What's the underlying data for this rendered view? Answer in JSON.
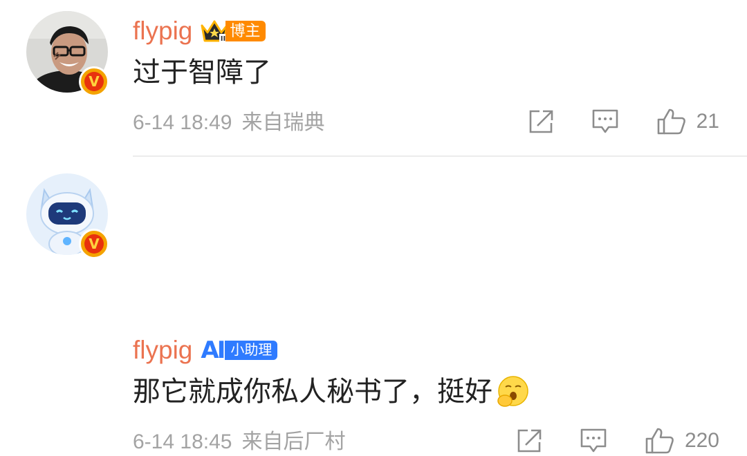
{
  "comments": [
    {
      "username": "flypig",
      "badge_type": "crown",
      "badge_label": "博主",
      "text": "过于智障了",
      "date": "6-14 18:49",
      "source": "来自瑞典",
      "likes": "21"
    },
    {
      "username": "flypig",
      "badge_type": "ai",
      "badge_letters": "AI",
      "badge_label": "小助理",
      "text": "那它就成你私人秘书了，挺好",
      "date": "6-14 18:45",
      "source": "来自后厂村",
      "likes": "220"
    }
  ],
  "verified_mark": "V",
  "colors": {
    "username": "#eb7350",
    "crown_badge": "#ff8a00",
    "ai_badge": "#2f7bff",
    "meta_text": "#a3a3a3",
    "icon": "#8c8c8c"
  },
  "icons": [
    "share-icon",
    "reply-icon",
    "like-icon",
    "yawn-emoji"
  ]
}
